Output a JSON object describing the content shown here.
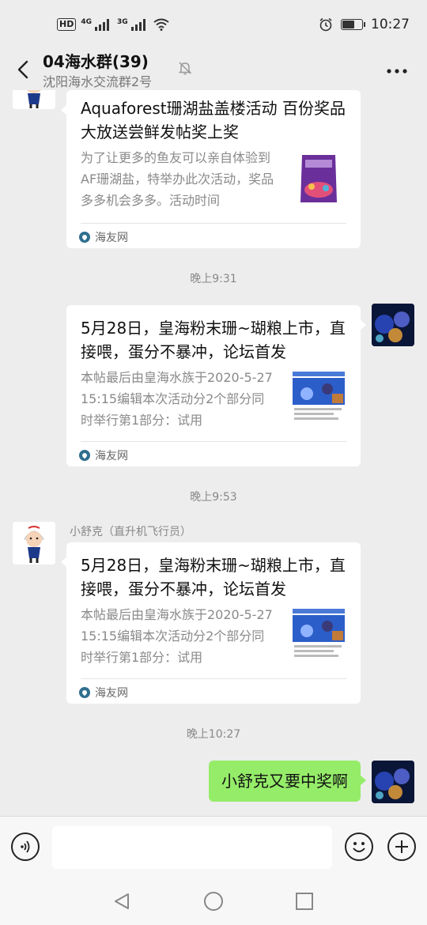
{
  "status_bar": {
    "hd_badge": "HD",
    "sim1_network": "4G",
    "sim2_network": "3G",
    "battery_level": 0.7,
    "time": "10:27"
  },
  "header": {
    "title": "04海水群(39)",
    "subtitle": "沈阳海水交流群2号"
  },
  "messages": {
    "card1": {
      "title": "Aquaforest珊湖盐盖楼活动 百份奖品大放送尝鲜发帖奖上奖",
      "desc": "为了让更多的鱼友可以亲自体验到AF珊湖盐，特举办此次活动，奖品多多机会多多。活动时间",
      "source": "海友网"
    },
    "time1": "晚上9:31",
    "card2": {
      "title": "5月28日，皇海粉末珊~瑚粮上市，直接喂，蛋分不暴冲，论坛首发",
      "desc": "本帖最后由皇海水族于2020-5-2715:15编辑本次活动分2个部分同时举行第1部分：试用",
      "source": "海友网"
    },
    "time2": "晚上9:53",
    "sender3": "小舒克（直升机飞行员）",
    "card3": {
      "title": "5月28日，皇海粉末珊~瑚粮上市，直接喂，蛋分不暴冲，论坛首发",
      "desc": "本帖最后由皇海水族于2020-5-2715:15编辑本次活动分2个部分同时举行第1部分：试用",
      "source": "海友网"
    },
    "time3": "晚上10:27",
    "text4": "小舒克又要中奖啊"
  },
  "input": {
    "placeholder": ""
  },
  "icons": {
    "back": "back-arrow-icon",
    "mute": "bell-muted-icon",
    "more": "more-icon",
    "voice": "voice-icon",
    "emoji": "emoji-icon",
    "plus": "plus-icon",
    "nav_back": "triangle-back-icon",
    "nav_home": "circle-home-icon",
    "nav_recent": "square-recent-icon"
  },
  "colors": {
    "background": "#ededed",
    "bubble_self": "#95ec69",
    "card": "#ffffff"
  }
}
